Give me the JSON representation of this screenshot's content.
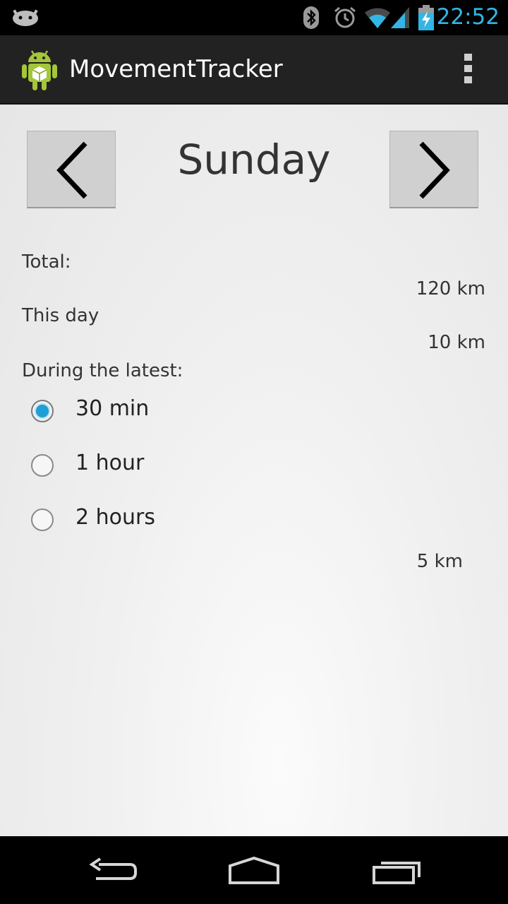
{
  "status_bar": {
    "time": "22:52",
    "icons": [
      "android-notification-icon",
      "bluetooth-icon",
      "alarm-icon",
      "wifi-icon",
      "signal-icon",
      "battery-charging-icon"
    ],
    "accent_color": "#33b5e5"
  },
  "action_bar": {
    "title": "MovementTracker",
    "icons": [
      "app-launcher-icon",
      "overflow-menu-icon"
    ]
  },
  "day_selector": {
    "day": "Sunday",
    "prev_icon": "chevron-left-icon",
    "next_icon": "chevron-right-icon"
  },
  "stats": {
    "total_label": "Total:",
    "total_value": "120 km",
    "day_label": "This day",
    "day_value": "10 km",
    "latest_label": "During the latest:"
  },
  "period_options": [
    {
      "label": "30 min",
      "checked": true
    },
    {
      "label": "1 hour",
      "checked": false
    },
    {
      "label": "2 hours",
      "checked": false
    }
  ],
  "latest_value": "5 km",
  "nav_bar": {
    "icons": [
      "back-icon",
      "home-icon",
      "recent-apps-icon"
    ]
  }
}
